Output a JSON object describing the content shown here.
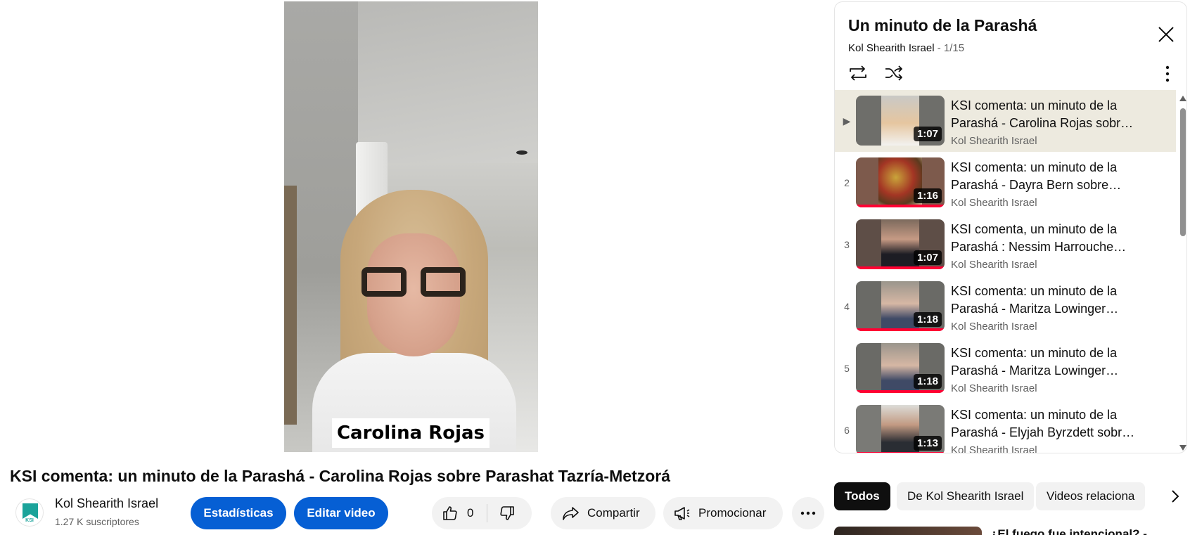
{
  "player": {
    "overlay_name": "Carolina Rojas"
  },
  "video": {
    "title": "KSI comenta: un minuto de la Parashá - Carolina Rojas sobre Parashat Tazría-Metzorá",
    "channel_name": "Kol Shearith Israel",
    "subscribers": "1.27 K suscriptores",
    "stats_label": "Estadísticas",
    "edit_label": "Editar video",
    "like_count": "0",
    "share_label": "Compartir",
    "promote_label": "Promocionar"
  },
  "playlist": {
    "title": "Un minuto de la Parashá",
    "owner": "Kol Shearith Israel",
    "position": " - 1/15",
    "items": [
      {
        "index": "▶",
        "title": "KSI comenta: un minuto de la Parashá - Carolina Rojas sobr…",
        "channel": "Kol Shearith Israel",
        "duration": "1:07",
        "active": true
      },
      {
        "index": "2",
        "title": "KSI comenta: un minuto de la Parashá - Dayra Bern sobre…",
        "channel": "Kol Shearith Israel",
        "duration": "1:16",
        "active": false
      },
      {
        "index": "3",
        "title": "KSI comenta, un minuto de la Parashá : Nessim Harrouche…",
        "channel": "Kol Shearith Israel",
        "duration": "1:07",
        "active": false
      },
      {
        "index": "4",
        "title": "KSI comenta: un minuto de la Parashá - Maritza Lowinger…",
        "channel": "Kol Shearith Israel",
        "duration": "1:18",
        "active": false
      },
      {
        "index": "5",
        "title": "KSI comenta: un minuto de la Parashá - Maritza Lowinger…",
        "channel": "Kol Shearith Israel",
        "duration": "1:18",
        "active": false
      },
      {
        "index": "6",
        "title": "KSI comenta: un minuto de la Parashá - Elyjah Byrzdett sobr…",
        "channel": "Kol Shearith Israel",
        "duration": "1:13",
        "active": false
      }
    ]
  },
  "chips": {
    "all": "Todos",
    "from_channel": "De Kol Shearith Israel",
    "related": "Videos relaciona"
  },
  "related": {
    "first_title": "¿El fuego fue intencional? -"
  },
  "colors": {
    "accent_blue": "#065fd4",
    "progress_red": "#ff0033",
    "active_row": "#edeadf"
  },
  "icons": {
    "like": "thumbs-up-icon",
    "dislike": "thumbs-down-icon",
    "share": "share-arrow-icon",
    "promote": "megaphone-icon",
    "more": "more-horizontal-icon",
    "close": "close-icon",
    "loop": "loop-icon",
    "shuffle": "shuffle-icon",
    "menu": "more-vertical-icon"
  }
}
